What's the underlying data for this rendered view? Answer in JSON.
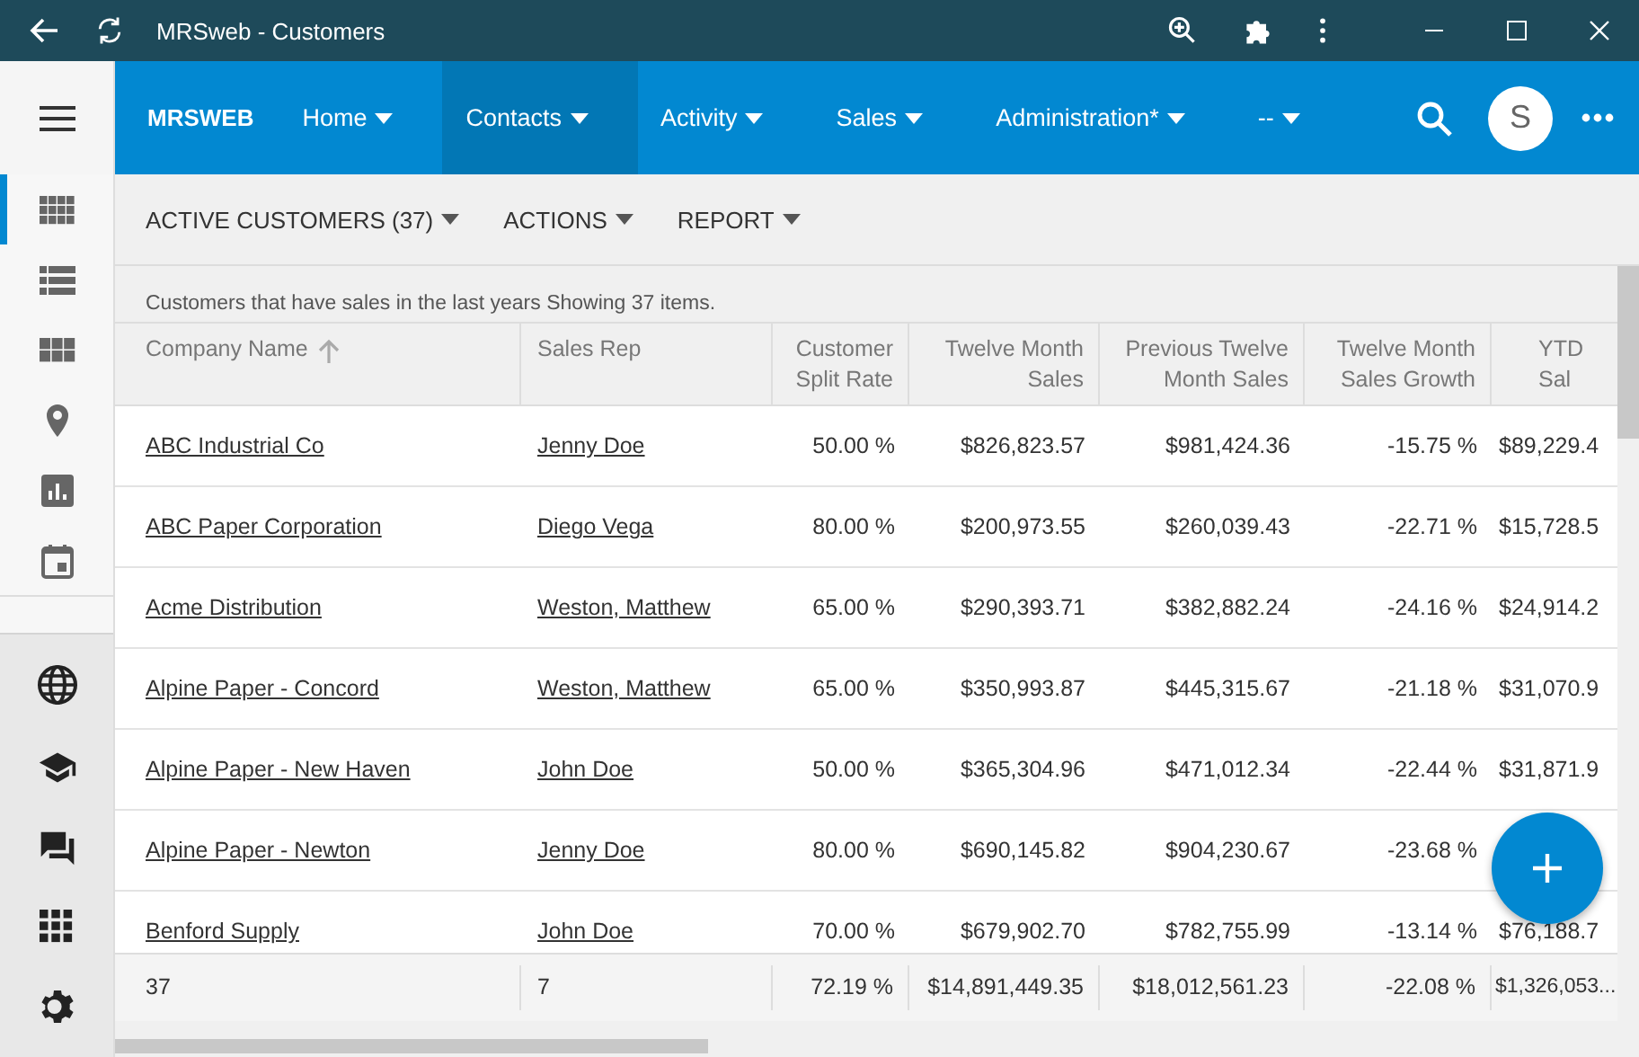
{
  "window": {
    "title": "MRSweb - Customers"
  },
  "nav": {
    "brand": "MRSWEB",
    "items": [
      {
        "label": "Home",
        "selected": false
      },
      {
        "label": "Contacts",
        "selected": true
      },
      {
        "label": "Activity",
        "selected": false
      },
      {
        "label": "Sales",
        "selected": false
      },
      {
        "label": "Administration*",
        "selected": false
      },
      {
        "label": "--",
        "selected": false
      }
    ],
    "avatar": "S"
  },
  "sidebar": {
    "items": [
      {
        "selected": true
      },
      {
        "selected": false
      },
      {
        "selected": false
      },
      {
        "selected": false
      },
      {
        "selected": false
      },
      {
        "selected": false
      }
    ]
  },
  "toolbar": [
    "ACTIVE CUSTOMERS (37)",
    "ACTIONS",
    "REPORT"
  ],
  "info": "Customers that have sales in the last years Showing 37 items.",
  "table": {
    "columns": [
      {
        "label": "Company Name",
        "sorted": true
      },
      {
        "label": "Sales Rep",
        "sorted": false
      },
      {
        "label": "Customer Split Rate",
        "sorted": false
      },
      {
        "label": "Twelve Month Sales",
        "sorted": false
      },
      {
        "label": "Previous Twelve Month Sales",
        "sorted": false
      },
      {
        "label": "Twelve Month Sales Growth",
        "sorted": false
      },
      {
        "label": "YTD Sal",
        "sorted": false
      }
    ],
    "rows": [
      {
        "company": "ABC Industrial Co",
        "rep": "Jenny Doe",
        "split": "50.00 %",
        "tms": "$826,823.57",
        "ptms": "$981,424.36",
        "growth": "-15.75 %",
        "ytd": "$89,229.4"
      },
      {
        "company": "ABC Paper Corporation",
        "rep": "Diego Vega",
        "split": "80.00 %",
        "tms": "$200,973.55",
        "ptms": "$260,039.43",
        "growth": "-22.71 %",
        "ytd": "$15,728.5"
      },
      {
        "company": "Acme Distribution",
        "rep": "Weston, Matthew",
        "split": "65.00 %",
        "tms": "$290,393.71",
        "ptms": "$382,882.24",
        "growth": "-24.16 %",
        "ytd": "$24,914.2"
      },
      {
        "company": "Alpine Paper - Concord",
        "rep": "Weston, Matthew",
        "split": "65.00 %",
        "tms": "$350,993.87",
        "ptms": "$445,315.67",
        "growth": "-21.18 %",
        "ytd": "$31,070.9"
      },
      {
        "company": "Alpine Paper - New Haven",
        "rep": "John Doe",
        "split": "50.00 %",
        "tms": "$365,304.96",
        "ptms": "$471,012.34",
        "growth": "-22.44 %",
        "ytd": "$31,871.9"
      },
      {
        "company": "Alpine Paper - Newton",
        "rep": "Jenny Doe",
        "split": "80.00 %",
        "tms": "$690,145.82",
        "ptms": "$904,230.67",
        "growth": "-23.68 %"
      },
      {
        "company": "Benford Supply",
        "rep": "John Doe",
        "split": "70.00 %",
        "tms": "$679,902.70",
        "ptms": "$782,755.99",
        "growth": "-13.14 %",
        "ytd": "$76,188.7"
      }
    ],
    "totals": [
      "37",
      "7",
      "72.19 %",
      "$14,891,449.35",
      "$18,012,561.23",
      "-22.08 %",
      "$1,326,053..."
    ]
  }
}
